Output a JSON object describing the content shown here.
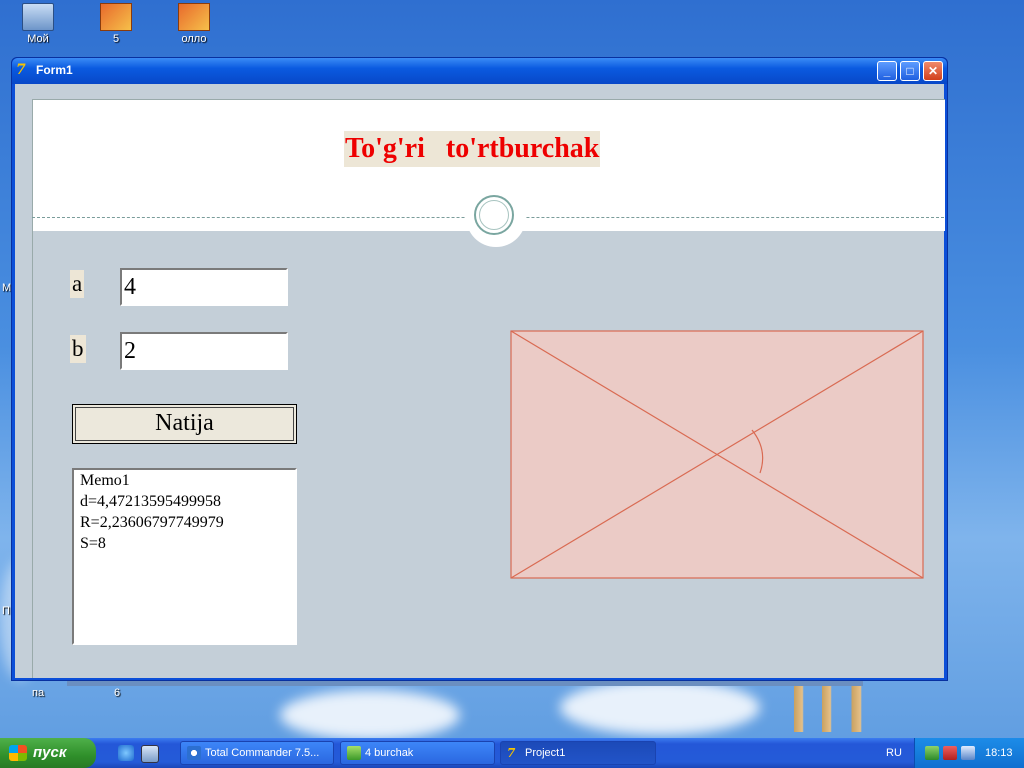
{
  "desktop": {
    "icons": [
      {
        "label": "Мой",
        "icon": "my-computer-icon"
      },
      {
        "label": "5",
        "icon": "app-shortcut-icon"
      },
      {
        "label": "олло",
        "icon": "app-shortcut-icon"
      }
    ],
    "stubs": [
      "па",
      "6",
      "М",
      "П"
    ]
  },
  "window": {
    "title": "Form1",
    "icon": "delphi-form-icon",
    "buttons": {
      "minimize": "minimize-icon",
      "maximize": "maximize-icon",
      "close": "close-icon"
    }
  },
  "form": {
    "heading": "To'g'ri   to'rtburchak",
    "label_a": "a",
    "label_b": "b",
    "input_a_value": "4",
    "input_b_value": "2",
    "button_label": "Natija",
    "memo_lines": [
      "Memo1",
      "d=4,47213595499958",
      "R=2,23606797749979",
      "S=8"
    ],
    "heading_color": "#ee0000",
    "rectangle_fill": "#ebcbc6",
    "rectangle_stroke": "#d96a52"
  },
  "taskbar": {
    "start_label": "пуск",
    "quick_launch": [
      "ie-icon",
      "show-desktop-icon"
    ],
    "tasks": [
      {
        "label": "Total Commander 7.5...",
        "icon": "total-commander-icon",
        "active": false
      },
      {
        "label": "4 burchak",
        "icon": "folder-icon",
        "active": false
      },
      {
        "label": "Project1",
        "icon": "delphi-app-icon",
        "active": true
      }
    ],
    "language": "RU",
    "tray_icons": [
      "network-icon",
      "safely-remove-icon",
      "volume-icon"
    ],
    "clock": "18:13"
  }
}
